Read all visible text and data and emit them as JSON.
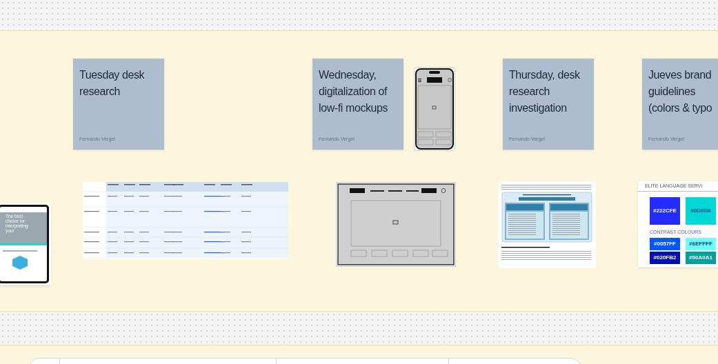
{
  "stickies": [
    {
      "text": "Tuesday desk research",
      "author": "Fernando Vergel"
    },
    {
      "text": "Wednesday, digitalization of low-fi mockups",
      "author": "Fernando Vergel"
    },
    {
      "text": "Thursday, desk research investigation",
      "author": "Fernando Vergel"
    },
    {
      "text": "Jueves brand guidelines (colors & typo",
      "author": "Fernando Vergel"
    }
  ],
  "website_preview": {
    "hero_text": "The best choice for interpreting your"
  },
  "brand_guide": {
    "title": "ELITE LANGUAGE SERVI",
    "primary": [
      {
        "label": "#222CFE",
        "color": "#222cfe"
      },
      {
        "label": "00D8D8",
        "color": "#00d8d8"
      }
    ],
    "contrast_title": "CONTRAST COLOURS",
    "contrast": [
      {
        "label": "#0057FF",
        "color": "#0057ff"
      },
      {
        "label": "#6EFFFF",
        "color": "#6effff"
      },
      {
        "label": "#020FB2",
        "color": "#020fb2"
      },
      {
        "label": "#00A0A1",
        "color": "#00a0a1"
      }
    ]
  }
}
